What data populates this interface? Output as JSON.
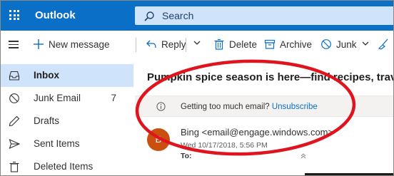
{
  "header": {
    "app_title": "Outlook",
    "search_placeholder": "Search"
  },
  "commands": {
    "new_message": "New message",
    "reply": "Reply",
    "delete": "Delete",
    "archive": "Archive",
    "junk": "Junk"
  },
  "nav": {
    "items": [
      {
        "label": "Inbox",
        "count": ""
      },
      {
        "label": "Junk Email",
        "count": "7"
      },
      {
        "label": "Drafts",
        "count": ""
      },
      {
        "label": "Sent Items",
        "count": ""
      },
      {
        "label": "Deleted Items",
        "count": ""
      }
    ]
  },
  "message": {
    "subject": "Pumpkin spice season is here—find recipes, travel t",
    "info_text": "Getting too much email?",
    "info_link": "Unsubscribe",
    "avatar_letter": "B",
    "sender": "Bing <email@engage.windows.com>",
    "date": "Wed 10/17/2018, 5:56 PM",
    "to_label": "To:"
  },
  "colors": {
    "brand": "#0a6fc6",
    "selected_nav": "#cfe4fa",
    "avatar": "#ca5010",
    "annotation": "#e0141e"
  }
}
